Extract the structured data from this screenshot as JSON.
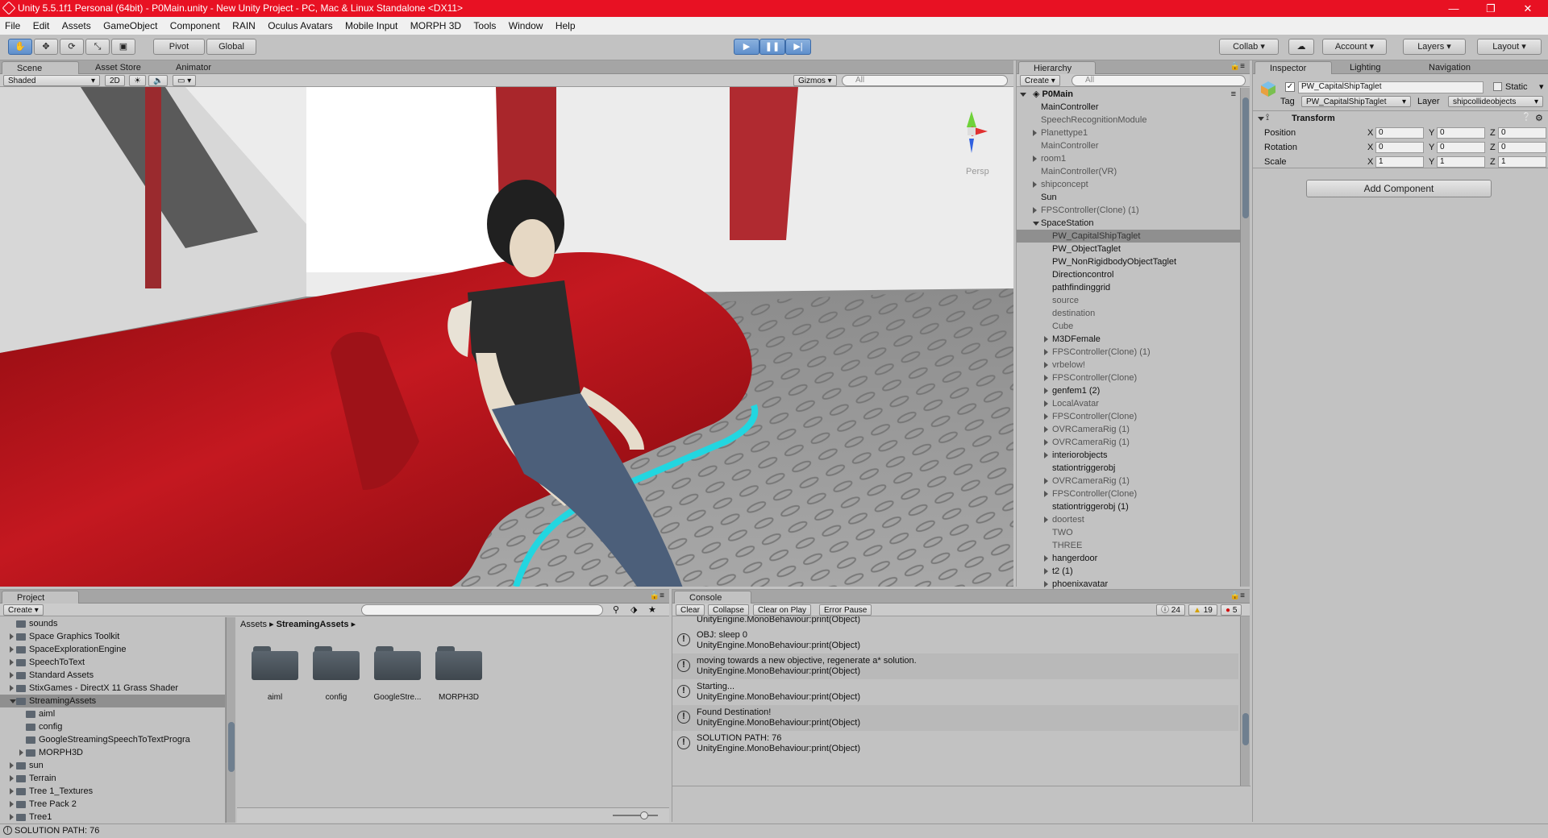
{
  "window": {
    "title": "Unity 5.5.1f1 Personal (64bit) - P0Main.unity - New Unity Project - PC, Mac & Linux Standalone <DX11>",
    "controls": [
      "—",
      "❐",
      "✕"
    ]
  },
  "menu": [
    "File",
    "Edit",
    "Assets",
    "GameObject",
    "Component",
    "RAIN",
    "Oculus Avatars",
    "Mobile Input",
    "MORPH 3D",
    "Tools",
    "Window",
    "Help"
  ],
  "toolbar": {
    "pivot": "Pivot",
    "global": "Global",
    "collab": "Collab",
    "account": "Account",
    "layers": "Layers",
    "layout": "Layout"
  },
  "scene": {
    "tabs": [
      "Scene",
      "Asset Store",
      "Animator"
    ],
    "shading": "Shaded",
    "mode2d": "2D",
    "gizmos": "Gizmos",
    "search_placeholder": "All",
    "persp": "Persp"
  },
  "hierarchy": {
    "tab": "Hierarchy",
    "create": "Create",
    "search_placeholder": "All",
    "scene_name": "P0Main",
    "rows": [
      {
        "label": "MainController",
        "depth": 1,
        "fold": "",
        "style": ""
      },
      {
        "label": "SpeechRecognitionModule",
        "depth": 1,
        "fold": "",
        "style": "dim"
      },
      {
        "label": "Planettype1",
        "depth": 1,
        "fold": "closed",
        "style": "dim"
      },
      {
        "label": "MainController",
        "depth": 1,
        "fold": "",
        "style": "dim"
      },
      {
        "label": "room1",
        "depth": 1,
        "fold": "closed",
        "style": "dim"
      },
      {
        "label": "MainController(VR)",
        "depth": 1,
        "fold": "",
        "style": "dim"
      },
      {
        "label": "shipconcept",
        "depth": 1,
        "fold": "closed",
        "style": "dim"
      },
      {
        "label": "Sun",
        "depth": 1,
        "fold": "",
        "style": ""
      },
      {
        "label": "FPSController(Clone) (1)",
        "depth": 1,
        "fold": "closed",
        "style": "dim"
      },
      {
        "label": "SpaceStation",
        "depth": 1,
        "fold": "open",
        "style": ""
      },
      {
        "label": "PW_CapitalShipTaglet",
        "depth": 2,
        "fold": "",
        "style": "sel"
      },
      {
        "label": "PW_ObjectTaglet",
        "depth": 2,
        "fold": "",
        "style": ""
      },
      {
        "label": "PW_NonRigidbodyObjectTaglet",
        "depth": 2,
        "fold": "",
        "style": ""
      },
      {
        "label": "Directioncontrol",
        "depth": 2,
        "fold": "",
        "style": ""
      },
      {
        "label": "pathfindinggrid",
        "depth": 2,
        "fold": "",
        "style": ""
      },
      {
        "label": "source",
        "depth": 2,
        "fold": "",
        "style": "dim"
      },
      {
        "label": "destination",
        "depth": 2,
        "fold": "",
        "style": "dim"
      },
      {
        "label": "Cube",
        "depth": 2,
        "fold": "",
        "style": "dim"
      },
      {
        "label": "M3DFemale",
        "depth": 2,
        "fold": "closed",
        "style": ""
      },
      {
        "label": "FPSController(Clone) (1)",
        "depth": 2,
        "fold": "closed",
        "style": "dim"
      },
      {
        "label": "vrbelow!",
        "depth": 2,
        "fold": "closed",
        "style": "dim"
      },
      {
        "label": "FPSController(Clone)",
        "depth": 2,
        "fold": "closed",
        "style": "dim"
      },
      {
        "label": "genfem1 (2)",
        "depth": 2,
        "fold": "closed",
        "style": ""
      },
      {
        "label": "LocalAvatar",
        "depth": 2,
        "fold": "closed",
        "style": "dim"
      },
      {
        "label": "FPSController(Clone)",
        "depth": 2,
        "fold": "closed",
        "style": "dim"
      },
      {
        "label": "OVRCameraRig (1)",
        "depth": 2,
        "fold": "closed",
        "style": "dim"
      },
      {
        "label": "OVRCameraRig (1)",
        "depth": 2,
        "fold": "closed",
        "style": "dim"
      },
      {
        "label": "interiorobjects",
        "depth": 2,
        "fold": "closed",
        "style": ""
      },
      {
        "label": "stationtriggerobj",
        "depth": 2,
        "fold": "",
        "style": ""
      },
      {
        "label": "OVRCameraRig (1)",
        "depth": 2,
        "fold": "closed",
        "style": "dim"
      },
      {
        "label": "FPSController(Clone)",
        "depth": 2,
        "fold": "closed",
        "style": "dim"
      },
      {
        "label": "stationtriggerobj (1)",
        "depth": 2,
        "fold": "",
        "style": ""
      },
      {
        "label": "doortest",
        "depth": 2,
        "fold": "closed",
        "style": "dim"
      },
      {
        "label": "TWO",
        "depth": 2,
        "fold": "",
        "style": "dim"
      },
      {
        "label": "THREE",
        "depth": 2,
        "fold": "",
        "style": "dim"
      },
      {
        "label": "hangerdoor",
        "depth": 2,
        "fold": "closed",
        "style": ""
      },
      {
        "label": "t2 (1)",
        "depth": 2,
        "fold": "closed",
        "style": ""
      },
      {
        "label": "phoenixavatar",
        "depth": 2,
        "fold": "closed",
        "style": ""
      }
    ]
  },
  "inspector": {
    "tabs": [
      "Inspector",
      "Lighting",
      "Navigation"
    ],
    "object_name": "PW_CapitalShipTaglet",
    "static_label": "Static",
    "tag_label": "Tag",
    "tag_value": "PW_CapitalShipTaglet",
    "layer_label": "Layer",
    "layer_value": "shipcollideobjects",
    "component_title": "Transform",
    "transform_rows": [
      {
        "label": "Position",
        "x": "0",
        "y": "0",
        "z": "0"
      },
      {
        "label": "Rotation",
        "x": "0",
        "y": "0",
        "z": "0"
      },
      {
        "label": "Scale",
        "x": "1",
        "y": "1",
        "z": "1"
      }
    ],
    "axis": [
      "X",
      "Y",
      "Z"
    ],
    "add_component": "Add Component"
  },
  "project": {
    "tab": "Project",
    "create": "Create",
    "tree": [
      {
        "label": "sounds",
        "depth": 1,
        "fold": ""
      },
      {
        "label": "Space Graphics Toolkit",
        "depth": 1,
        "fold": "closed"
      },
      {
        "label": "SpaceExplorationEngine",
        "depth": 1,
        "fold": "closed"
      },
      {
        "label": "SpeechToText",
        "depth": 1,
        "fold": "closed"
      },
      {
        "label": "Standard Assets",
        "depth": 1,
        "fold": "closed"
      },
      {
        "label": "StixGames - DirectX 11 Grass Shader",
        "depth": 1,
        "fold": "closed"
      },
      {
        "label": "StreamingAssets",
        "depth": 1,
        "fold": "open",
        "sel": true
      },
      {
        "label": "aiml",
        "depth": 2,
        "fold": ""
      },
      {
        "label": "config",
        "depth": 2,
        "fold": ""
      },
      {
        "label": "GoogleStreamingSpeechToTextProgra",
        "depth": 2,
        "fold": ""
      },
      {
        "label": "MORPH3D",
        "depth": 2,
        "fold": "closed"
      },
      {
        "label": "sun",
        "depth": 1,
        "fold": "closed"
      },
      {
        "label": "Terrain",
        "depth": 1,
        "fold": "closed"
      },
      {
        "label": "Tree 1_Textures",
        "depth": 1,
        "fold": "closed"
      },
      {
        "label": "Tree Pack 2",
        "depth": 1,
        "fold": "closed"
      },
      {
        "label": "Tree1",
        "depth": 1,
        "fold": "closed"
      }
    ],
    "breadcrumb_root": "Assets",
    "breadcrumb_sep": "▸",
    "breadcrumb_current": "StreamingAssets",
    "folders": [
      "aiml",
      "config",
      "GoogleStre...",
      "MORPH3D"
    ]
  },
  "console": {
    "tab": "Console",
    "buttons": [
      "Clear",
      "Collapse",
      "Clear on Play",
      "Error Pause"
    ],
    "counts": {
      "log": "24",
      "warn": "19",
      "error": "5"
    },
    "entries": [
      {
        "line1": "OBJ: sleep 0",
        "line2": "UnityEngine.MonoBehaviour:print(Object)"
      },
      {
        "line1": "moving towards a new objective, regenerate a* solution.",
        "line2": "UnityEngine.MonoBehaviour:print(Object)"
      },
      {
        "line1": "Starting...",
        "line2": "UnityEngine.MonoBehaviour:print(Object)"
      },
      {
        "line1": "Found Destination!",
        "line2": "UnityEngine.MonoBehaviour:print(Object)"
      },
      {
        "line1": "SOLUTION PATH: 76",
        "line2": "UnityEngine.MonoBehaviour:print(Object)"
      }
    ],
    "partial_top": "UnityEngine.MonoBehaviour:print(Object)"
  },
  "status": "SOLUTION PATH: 76",
  "colors": {
    "titlebar": "#e81123",
    "play_active": "#5f8fcc",
    "couch_red": "#b0121a",
    "cyan_trim": "#22d6e0"
  }
}
